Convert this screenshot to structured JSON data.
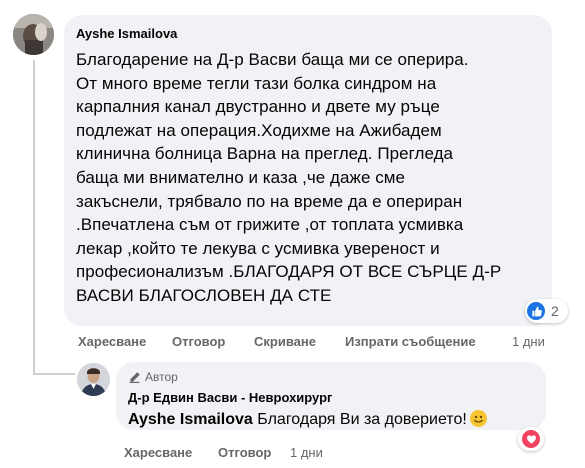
{
  "comment": {
    "author": "Ayshe Ismailova",
    "body": "Благодарение на Д-р Васви баща ми се оперира.\nОт много време тегли тази болка синдром на\nкарпалния канал двустранно и двете му ръце\nподлежат на операция.Ходихме на Ажибадем\nклинична болница Варна на преглед. Прегледа\nбаща ми внимателно и каза ,че даже сме\nзакъснели, трябвало по на време да е опериран\n.Впечатлена съм от грижите ,от топлата усмивка\nлекар ,който те лекува с усмивка увереност и\nпрофесионализъм .БЛАГОДАРЯ ОТ ВСЕ СЪРЦЕ Д-Р\nВАСВИ БЛАГОСЛОВЕН ДА СТЕ",
    "reaction_icons": [
      "like-icon",
      "love-icon"
    ],
    "reaction_count": "2",
    "actions": {
      "like": "Харесване",
      "reply": "Отговор",
      "hide": "Скриване",
      "send_message": "Изпрати съобщение",
      "time": "1 дни"
    }
  },
  "reply": {
    "badge_icon": "pencil-icon",
    "badge": "Автор",
    "author": "Д-р Едвин Васви - Неврохирург",
    "mention": "Ayshe Ismailova",
    "text": "Благодаря Ви за доверието!",
    "emoji": "smile-emoji",
    "reaction_icon": "love-icon",
    "actions": {
      "like": "Харесване",
      "reply": "Отговор",
      "time": "1 дни"
    }
  },
  "colors": {
    "bubble": "#f0f2f5",
    "secondary_text": "#65676b",
    "like_blue": "#1b74e4",
    "love_red": "#f3425f"
  }
}
